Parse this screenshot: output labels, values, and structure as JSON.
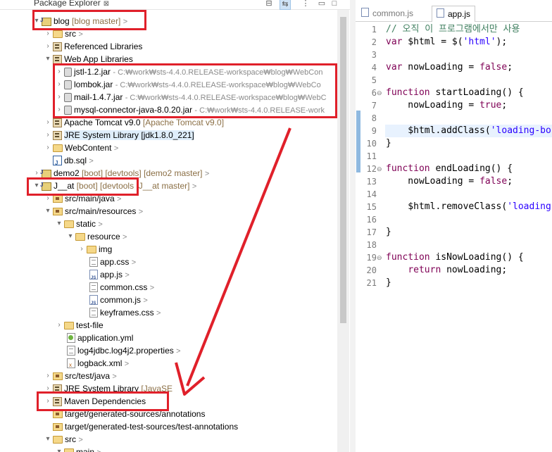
{
  "explorer": {
    "tab_label": "Package Explorer",
    "tab_close": "⊠",
    "toolbar": {
      "collapse": "⊟",
      "link": "⇆",
      "menu": "⋮",
      "minimize": "▭",
      "maximize": "□"
    }
  },
  "tree": {
    "blog": {
      "name": "blog",
      "decoration": "[blog master]",
      "arrow": ">"
    },
    "blog_src": {
      "name": "src",
      "arrow": ">"
    },
    "ref_libs": {
      "name": "Referenced Libraries"
    },
    "webapp_libs": {
      "name": "Web App Libraries"
    },
    "jars": [
      {
        "name": "jstl-1.2.jar",
        "path": "- C:₩work₩sts-4.4.0.RELEASE-workspace₩blog₩WebCon"
      },
      {
        "name": "lombok.jar",
        "path": "- C:₩work₩sts-4.4.0.RELEASE-workspace₩blog₩WebCo"
      },
      {
        "name": "mail-1.4.7.jar",
        "path": "- C:₩work₩sts-4.4.0.RELEASE-workspace₩blog₩WebC"
      },
      {
        "name": "mysql-connector-java-8.0.20.jar",
        "path": "- C:₩work₩sts-4.4.0.RELEASE-work"
      }
    ],
    "tomcat": {
      "name": "Apache Tomcat v9.0",
      "decoration": "[Apache Tomcat v9.0]"
    },
    "jre_blog": {
      "name": "JRE System Library",
      "decoration": "[jdk1.8.0_221]"
    },
    "webcontent": {
      "name": "WebContent",
      "arrow": ">"
    },
    "dbsql": {
      "name": "db.sql",
      "arrow": ">"
    },
    "demo2": {
      "name": "demo2",
      "decoration": "[boot] [devtools] [demo2 master]",
      "arrow": ">"
    },
    "jat": {
      "name": "J__at",
      "decoration": "[boot] [devtools",
      "decoration_tail": "[J__at master]",
      "arrow": ">"
    },
    "src_main_java": {
      "name": "src/main/java",
      "arrow": ">"
    },
    "src_main_resources": {
      "name": "src/main/resources",
      "arrow": ">"
    },
    "static": {
      "name": "static",
      "arrow": ">"
    },
    "resource": {
      "name": "resource",
      "arrow": ">"
    },
    "img": {
      "name": "img"
    },
    "app_css": {
      "name": "app.css",
      "arrow": ">"
    },
    "app_js": {
      "name": "app.js",
      "arrow": ">"
    },
    "common_css": {
      "name": "common.css",
      "arrow": ">"
    },
    "common_js": {
      "name": "common.js",
      "arrow": ">"
    },
    "keyframes_css": {
      "name": "keyframes.css",
      "arrow": ">"
    },
    "test_file": {
      "name": "test-file"
    },
    "application_yml": {
      "name": "application.yml"
    },
    "log4jdbc": {
      "name": "log4jdbc.log4j2.properties",
      "arrow": ">"
    },
    "logback": {
      "name": "logback.xml",
      "arrow": ">"
    },
    "src_test_java": {
      "name": "src/test/java",
      "arrow": ">"
    },
    "jre_jat": {
      "name": "JRE System Library",
      "decoration": "[JavaSE"
    },
    "maven_deps": {
      "name": "Maven Dependencies"
    },
    "gen_sources": {
      "name": "target/generated-sources/annotations"
    },
    "gen_test_sources": {
      "name": "target/generated-test-sources/test-annotations"
    },
    "jat_src": {
      "name": "src",
      "arrow": ">"
    },
    "jat_main": {
      "name": "main",
      "arrow": ">"
    }
  },
  "editor": {
    "tabs": [
      {
        "label": "common.js"
      },
      {
        "label": "app.js"
      }
    ],
    "lines": [
      {
        "n": "1",
        "code": "// 오직 이 프로그램에서만 사용"
      },
      {
        "n": "2",
        "code": "var $html = $('html');"
      },
      {
        "n": "3",
        "code": ""
      },
      {
        "n": "4",
        "code": "var nowLoading = false;"
      },
      {
        "n": "5",
        "code": ""
      },
      {
        "n": "6",
        "code": "function startLoading() {"
      },
      {
        "n": "7",
        "code": "    nowLoading = true;"
      },
      {
        "n": "8",
        "code": ""
      },
      {
        "n": "9",
        "code": "    $html.addClass('loading-bo"
      },
      {
        "n": "10",
        "code": "}"
      },
      {
        "n": "11",
        "code": ""
      },
      {
        "n": "12",
        "code": "function endLoading() {"
      },
      {
        "n": "13",
        "code": "    nowLoading = false;"
      },
      {
        "n": "14",
        "code": ""
      },
      {
        "n": "15",
        "code": "    $html.removeClass('loading"
      },
      {
        "n": "16",
        "code": ""
      },
      {
        "n": "17",
        "code": "}"
      },
      {
        "n": "18",
        "code": ""
      },
      {
        "n": "19",
        "code": "function isNowLoading() {"
      },
      {
        "n": "20",
        "code": "    return nowLoading;"
      },
      {
        "n": "21",
        "code": "}"
      }
    ]
  },
  "colors": {
    "annotation": "#e0202a",
    "keyword": "#7f0055",
    "comment": "#3f7f5f",
    "string": "#2a00ff"
  }
}
